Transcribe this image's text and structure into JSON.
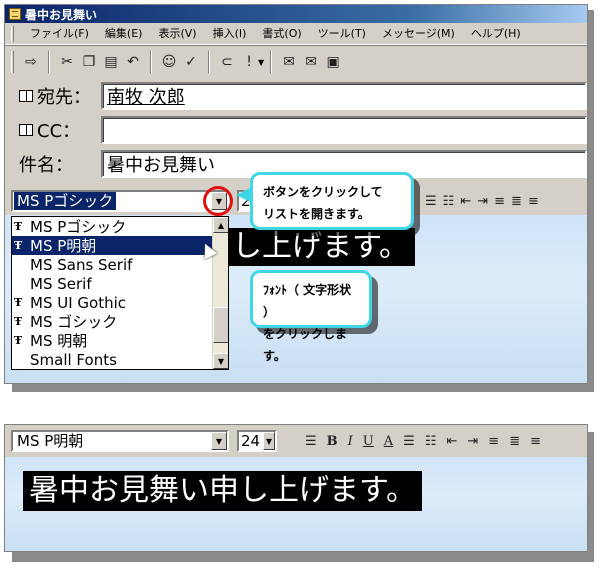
{
  "window": {
    "title": "暑中お見舞い"
  },
  "menu": [
    "ファイル(F)",
    "編集(E)",
    "表示(V)",
    "挿入(I)",
    "書式(O)",
    "ツール(T)",
    "メッセージ(M)",
    "ヘルプ(H)"
  ],
  "toolbar_icons": [
    "send-icon",
    "cut-icon",
    "copy-icon",
    "paste-icon",
    "undo-icon",
    "check-names-icon",
    "spelling-icon",
    "attach-icon",
    "priority-icon",
    "sign-icon",
    "encrypt-icon",
    "offline-icon"
  ],
  "fields": {
    "to_label": "宛先：",
    "to_value": "南牧 次郎",
    "cc_label": "CC：",
    "cc_value": "",
    "subject_label": "件名：",
    "subject_value": "暑中お見舞い"
  },
  "format_top": {
    "font_value": "MS Pゴシック",
    "size_value": "24"
  },
  "font_list": [
    {
      "name": "MS Pゴシック",
      "tt": true,
      "selected": false
    },
    {
      "name": "MS P明朝",
      "tt": true,
      "selected": true
    },
    {
      "name": "MS Sans Serif",
      "tt": false,
      "selected": false
    },
    {
      "name": "MS Serif",
      "tt": false,
      "selected": false
    },
    {
      "name": "MS UI Gothic",
      "tt": true,
      "selected": false
    },
    {
      "name": "MS ゴシック",
      "tt": true,
      "selected": false
    },
    {
      "name": "MS 明朝",
      "tt": true,
      "selected": false
    },
    {
      "name": "Small Fonts",
      "tt": false,
      "selected": false
    }
  ],
  "body_text_top": "し上げます。",
  "callouts": {
    "c1_line1": "ボタンをクリックして",
    "c1_line2": "リストを開きます。",
    "c2_line1": "ﾌｫﾝﾄ（ 文字形状 ）",
    "c2_line2": "をクリックします。"
  },
  "format_bottom": {
    "font_value": "MS P明朝",
    "size_value": "24",
    "bold_label": "B",
    "italic_label": "I",
    "underline_label": "U",
    "color_label": "A"
  },
  "body_text_bottom": "暑中お見舞い申し上げます。",
  "colors": {
    "selection": "#0a246a",
    "callout_border": "#3fd6e6",
    "highlight_circle": "#e01010"
  }
}
